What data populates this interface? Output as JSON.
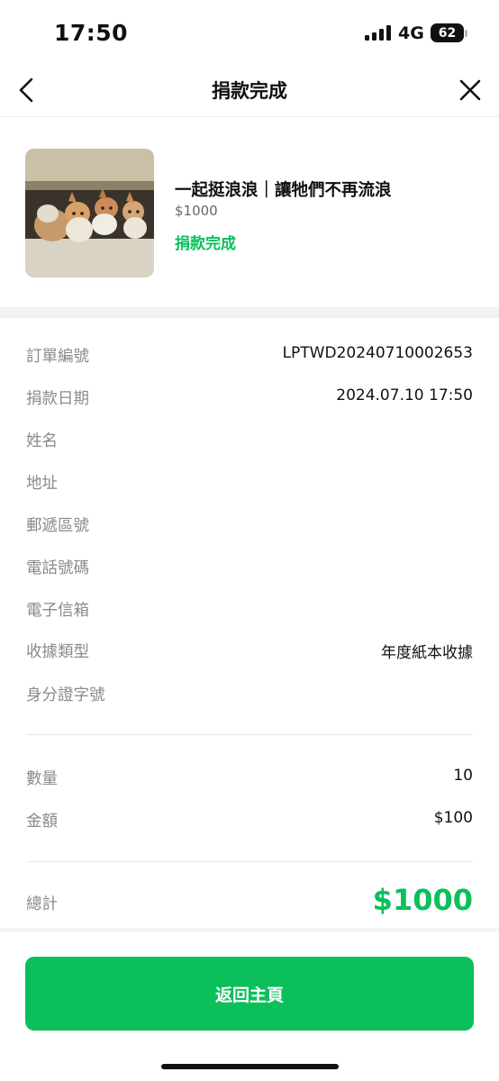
{
  "status_bar": {
    "time": "17:50",
    "network": "4G",
    "battery": "62"
  },
  "header": {
    "title": "捐款完成",
    "back_icon": "chevron-left-icon",
    "close_icon": "close-icon"
  },
  "product": {
    "title": "一起挺浪浪｜讓牠們不再流浪",
    "price": "$1000",
    "status": "捐款完成",
    "image": "kittens-photo"
  },
  "details": [
    {
      "label": "訂單編號",
      "value": "LPTWD20240710002653"
    },
    {
      "label": "捐款日期",
      "value": "2024.07.10 17:50"
    },
    {
      "label": "姓名",
      "value": ""
    },
    {
      "label": "地址",
      "value": ""
    },
    {
      "label": "郵遞區號",
      "value": ""
    },
    {
      "label": "電話號碼",
      "value": ""
    },
    {
      "label": "電子信箱",
      "value": ""
    },
    {
      "label": "收據類型",
      "value": "年度紙本收據"
    },
    {
      "label": "身分證字號",
      "value": ""
    }
  ],
  "summary": [
    {
      "label": "數量",
      "value": "10"
    },
    {
      "label": "金額",
      "value": "$100"
    }
  ],
  "total": {
    "label": "總計",
    "value": "$1000"
  },
  "home_button": {
    "label": "返回主頁"
  },
  "colors": {
    "accent": "#0bbf5a",
    "label": "#8a8a8a",
    "divider": "#f2f2f2"
  }
}
